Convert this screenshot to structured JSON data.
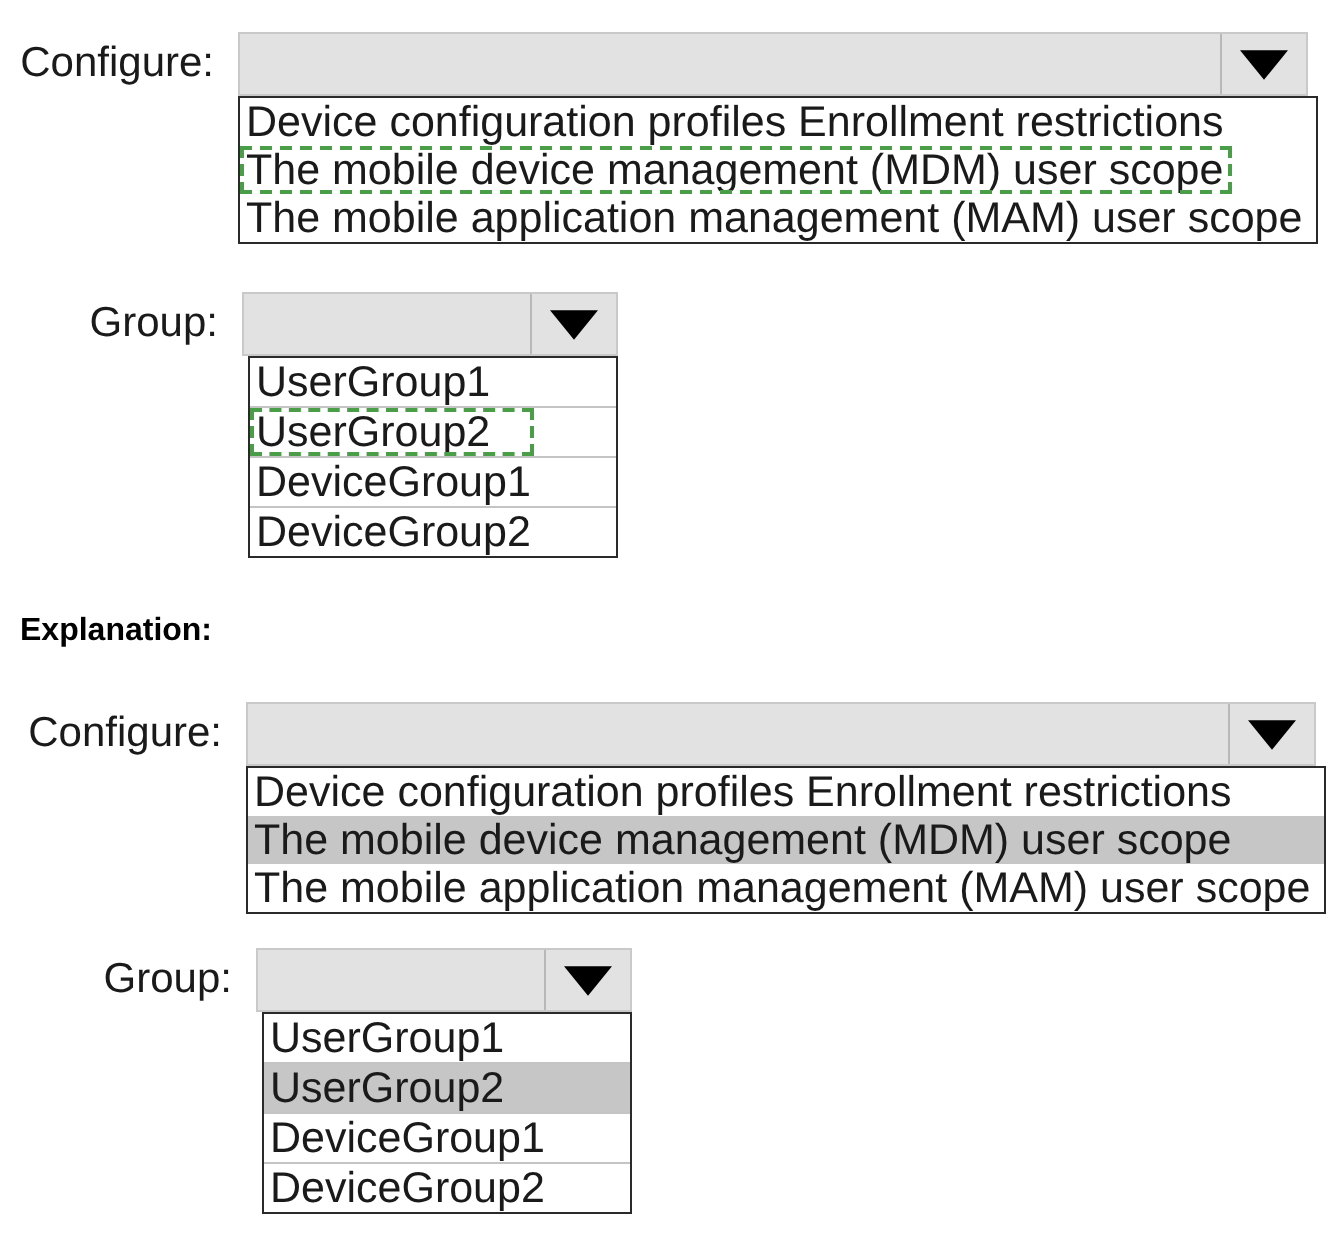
{
  "answer_area": {
    "kind": "dashed",
    "dropdowns": [
      {
        "label": "Configure:",
        "options": [
          {
            "text": "Device configuration profiles Enrollment restrictions",
            "selected": false
          },
          {
            "text": "The mobile device management (MDM) user scope",
            "selected": true
          },
          {
            "text": "The mobile application management (MAM) user scope",
            "selected": false
          }
        ]
      },
      {
        "label": "Group:",
        "options": [
          {
            "text": "UserGroup1",
            "selected": false
          },
          {
            "text": "UserGroup2",
            "selected": true
          },
          {
            "text": "DeviceGroup1",
            "selected": false
          },
          {
            "text": "DeviceGroup2",
            "selected": false
          }
        ]
      }
    ]
  },
  "explanation": {
    "heading": "Explanation:",
    "kind": "shaded",
    "dropdowns": [
      {
        "label": "Configure:",
        "options": [
          {
            "text": "Device configuration profiles Enrollment restrictions",
            "selected": false
          },
          {
            "text": "The mobile device management (MDM) user scope",
            "selected": true
          },
          {
            "text": "The mobile application management (MAM) user scope",
            "selected": false
          }
        ]
      },
      {
        "label": "Group:",
        "options": [
          {
            "text": "UserGroup1",
            "selected": false
          },
          {
            "text": "UserGroup2",
            "selected": true
          },
          {
            "text": "DeviceGroup1",
            "selected": false
          },
          {
            "text": "DeviceGroup2",
            "selected": false
          }
        ]
      }
    ]
  }
}
